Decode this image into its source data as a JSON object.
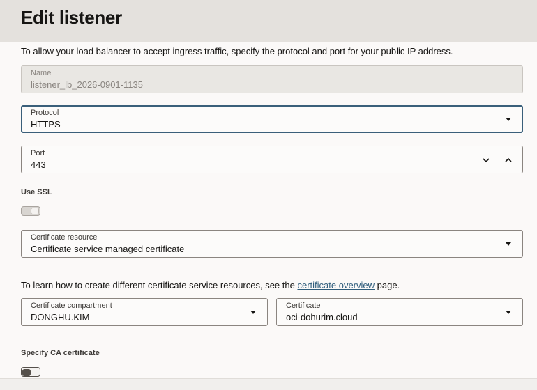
{
  "header": {
    "title": "Edit listener"
  },
  "intro": "To allow your load balancer to accept ingress traffic, specify the protocol and port for your public IP address.",
  "name_field": {
    "label": "Name",
    "value": "listener_lb_2026-0901-1135"
  },
  "protocol_field": {
    "label": "Protocol",
    "value": "HTTPS"
  },
  "port_field": {
    "label": "Port",
    "value": "443"
  },
  "use_ssl": {
    "label": "Use SSL",
    "enabled": true,
    "disabled": true
  },
  "certificate_resource": {
    "label": "Certificate resource",
    "value": "Certificate service managed certificate"
  },
  "help": {
    "prefix": "To learn how to create different certificate service resources, see the ",
    "link": "certificate overview",
    "suffix": " page."
  },
  "certificate_compartment": {
    "label": "Certificate compartment",
    "value": "DONGHU.KIM"
  },
  "certificate": {
    "label": "Certificate",
    "value": "oci-dohurim.cloud"
  },
  "specify_ca": {
    "label": "Specify CA certificate",
    "enabled": false
  },
  "icons": [
    "dropdown-caret-icon",
    "chevron-down-icon",
    "chevron-up-icon"
  ],
  "colors": {
    "link": "#2f5d7c",
    "focus_border": "#3a5f7a",
    "header_bg": "#e4e1dd"
  }
}
